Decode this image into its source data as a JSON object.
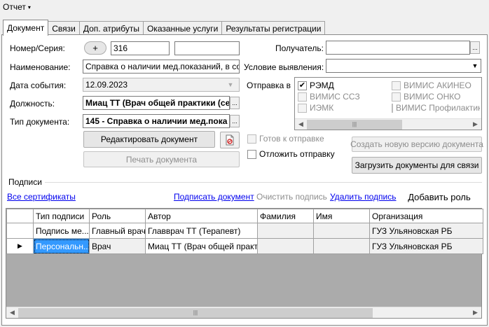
{
  "menu": {
    "report_label": "Отчет",
    "caret": "▾"
  },
  "tabs": [
    {
      "label": "Документ",
      "active": true
    },
    {
      "label": "Связи"
    },
    {
      "label": "Доп. атрибуты"
    },
    {
      "label": "Оказанные услуги"
    },
    {
      "label": "Результаты регистрации"
    }
  ],
  "form": {
    "number_label": "Номер/Серия:",
    "number_btn": "+",
    "number_value": "316",
    "series_value": "",
    "name_label": "Наименование:",
    "name_value": "Справка о наличии мед.показаний, в соотв",
    "date_label": "Дата события:",
    "date_value": "12.09.2023",
    "position_label": "Должность:",
    "position_value": "Миац ТТ (Врач общей практики (се",
    "doctype_label": "Тип документа:",
    "doctype_value": "145 - Справка о наличии мед.пока",
    "recipient_label": "Получатель:",
    "recipient_value": "",
    "condition_label": "Условие выявления:",
    "condition_value": "",
    "send_label": "Отправка в",
    "ellipsis": "...",
    "dd_arrow": "▼"
  },
  "send_targets": [
    {
      "label": "РЭМД",
      "checked": true,
      "enabled": true
    },
    {
      "label": "ВИМИС АКИНЕО",
      "checked": false,
      "enabled": false
    },
    {
      "label": "ВИМИС ССЗ",
      "checked": false,
      "enabled": false
    },
    {
      "label": "ВИМИС ОНКО",
      "checked": false,
      "enabled": false
    },
    {
      "label": "ИЭМК",
      "checked": false,
      "enabled": false
    },
    {
      "label": "ВИМИС Профилактика",
      "checked": false,
      "enabled": false
    }
  ],
  "scroll": {
    "left": "◀",
    "right": "▶",
    "thumb": "|||"
  },
  "actions": {
    "edit_doc": "Редактировать документ",
    "print_doc": "Печать документа",
    "ready_to_send": "Готов к отправке",
    "postpone_send": "Отложить отправку",
    "new_version": "Создать новую версию документа",
    "load_docs": "Загрузить документы для связи"
  },
  "signatures": {
    "group_label": "Подписи",
    "all_certs": "Все сертификаты",
    "sign_doc": "Подписать документ",
    "clear_sig": "Очистить подпись",
    "delete_sig": "Удалить подпись",
    "add_role": "Добавить роль",
    "columns": [
      "Тип подписи",
      "Роль",
      "Автор",
      "Фамилия",
      "Имя",
      "Организация"
    ],
    "rows": [
      {
        "marker": "",
        "type": "Подпись ме...",
        "role": "Главный врач",
        "author": "Главврач ТТ (Терапевт)",
        "surname": "",
        "name": "",
        "org": "ГУЗ Ульяновская РБ"
      },
      {
        "marker": "▶",
        "type": "Персональн...",
        "role": "Врач",
        "author": "Миац ТТ (Врач общей практ...",
        "surname": "",
        "name": "",
        "org": "ГУЗ Ульяновская РБ"
      }
    ]
  }
}
